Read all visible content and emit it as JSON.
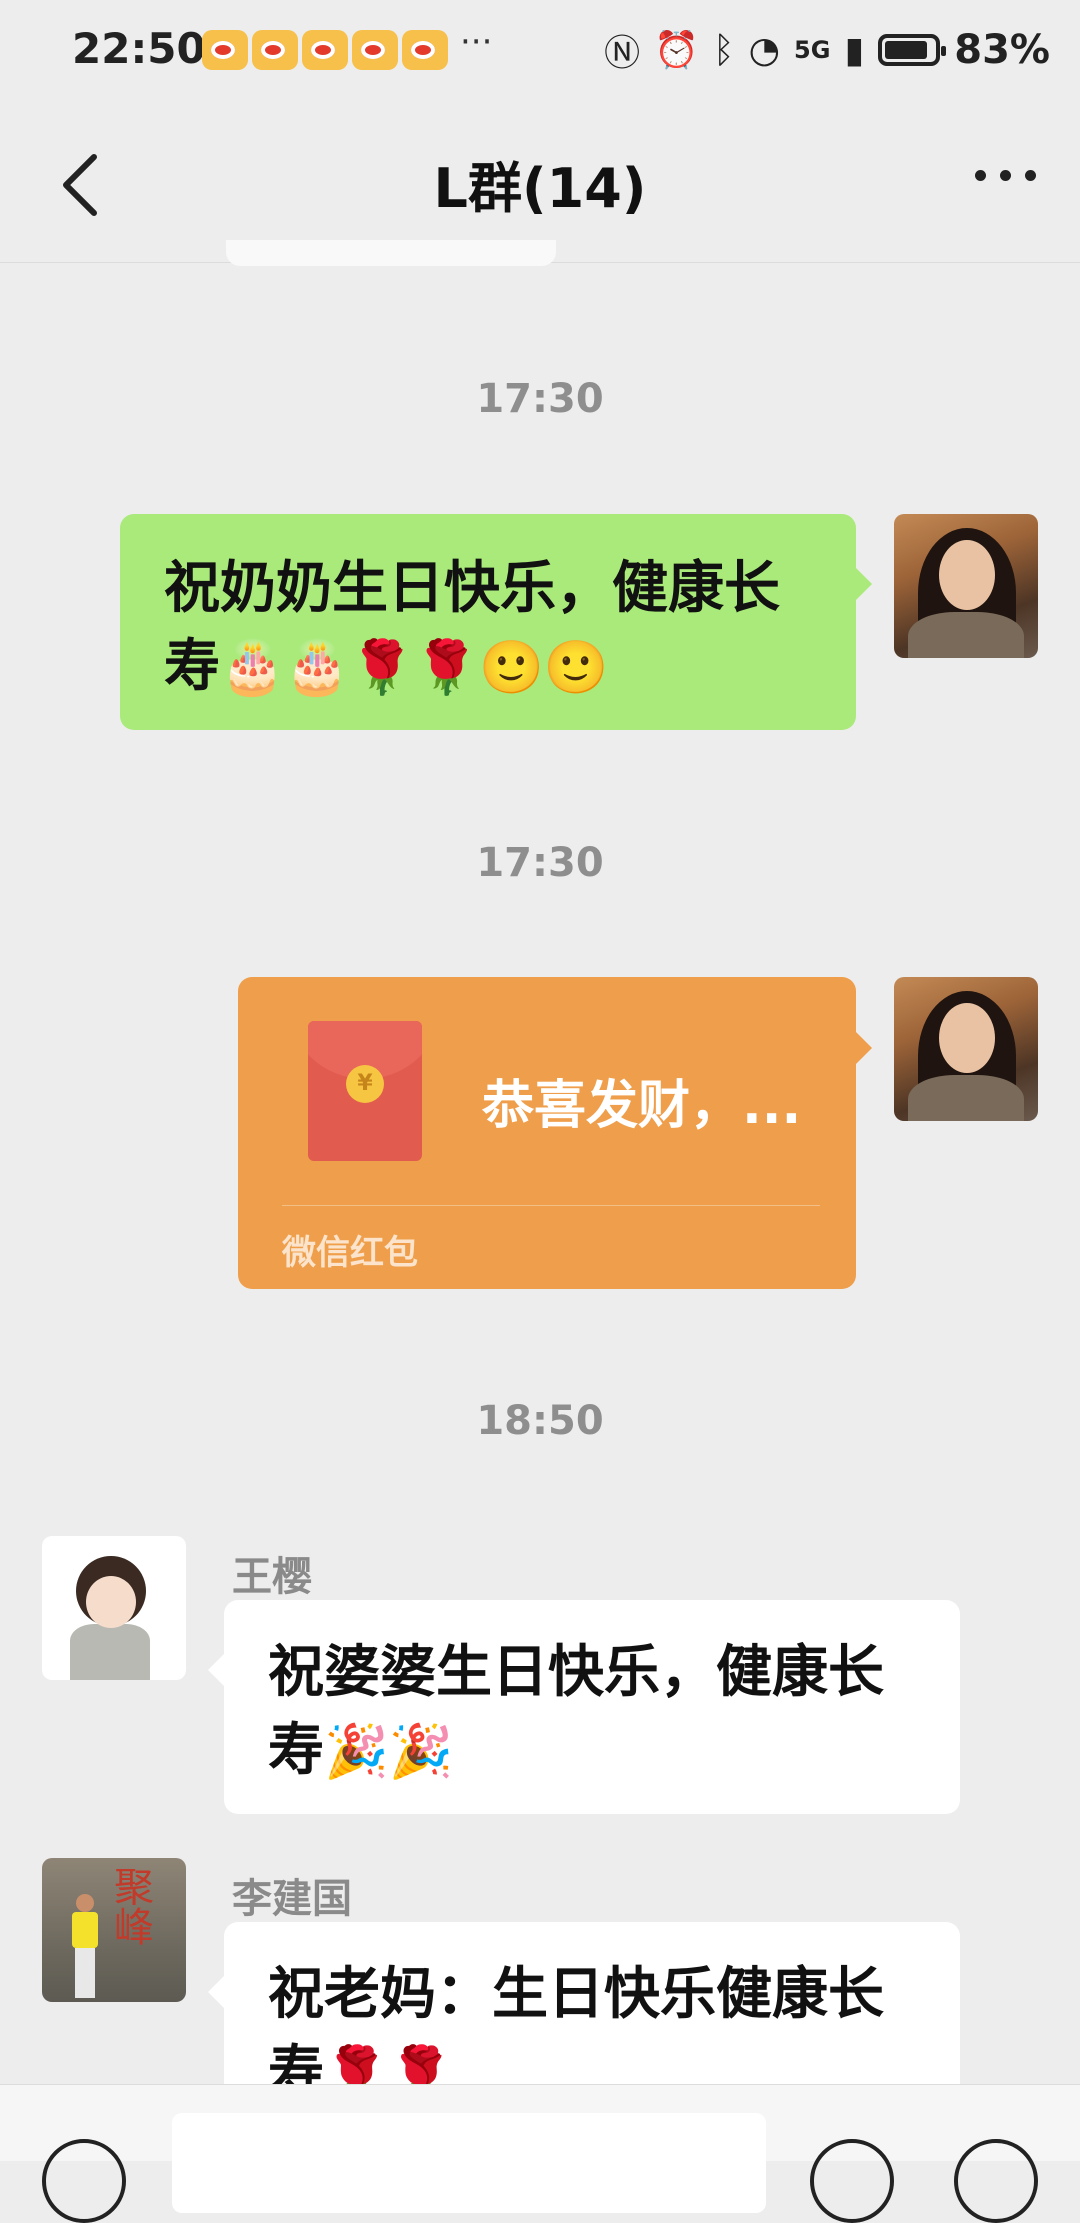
{
  "status_bar": {
    "time": "22:50",
    "more": "···",
    "network": "5G",
    "battery_percent": "83%"
  },
  "header": {
    "title": "L群(14)"
  },
  "messages": [
    {
      "timestamp": "17:30"
    },
    {
      "text": "祝奶奶生日快乐，健康长寿",
      "emojis": "🎂🎂🌹🌹🙂🙂"
    },
    {
      "timestamp": "17:30"
    },
    {
      "red_packet_title": "恭喜发财，...",
      "red_packet_label": "微信红包"
    },
    {
      "timestamp": "18:50"
    },
    {
      "sender": "王樱",
      "text": "祝婆婆生日快乐，健康长寿",
      "emojis": "🎉🎉"
    },
    {
      "sender": "李建国",
      "text": "祝老妈：生日快乐健康长寿",
      "emojis": "🌹🌹"
    }
  ],
  "avatar_li_text": "聚峰"
}
